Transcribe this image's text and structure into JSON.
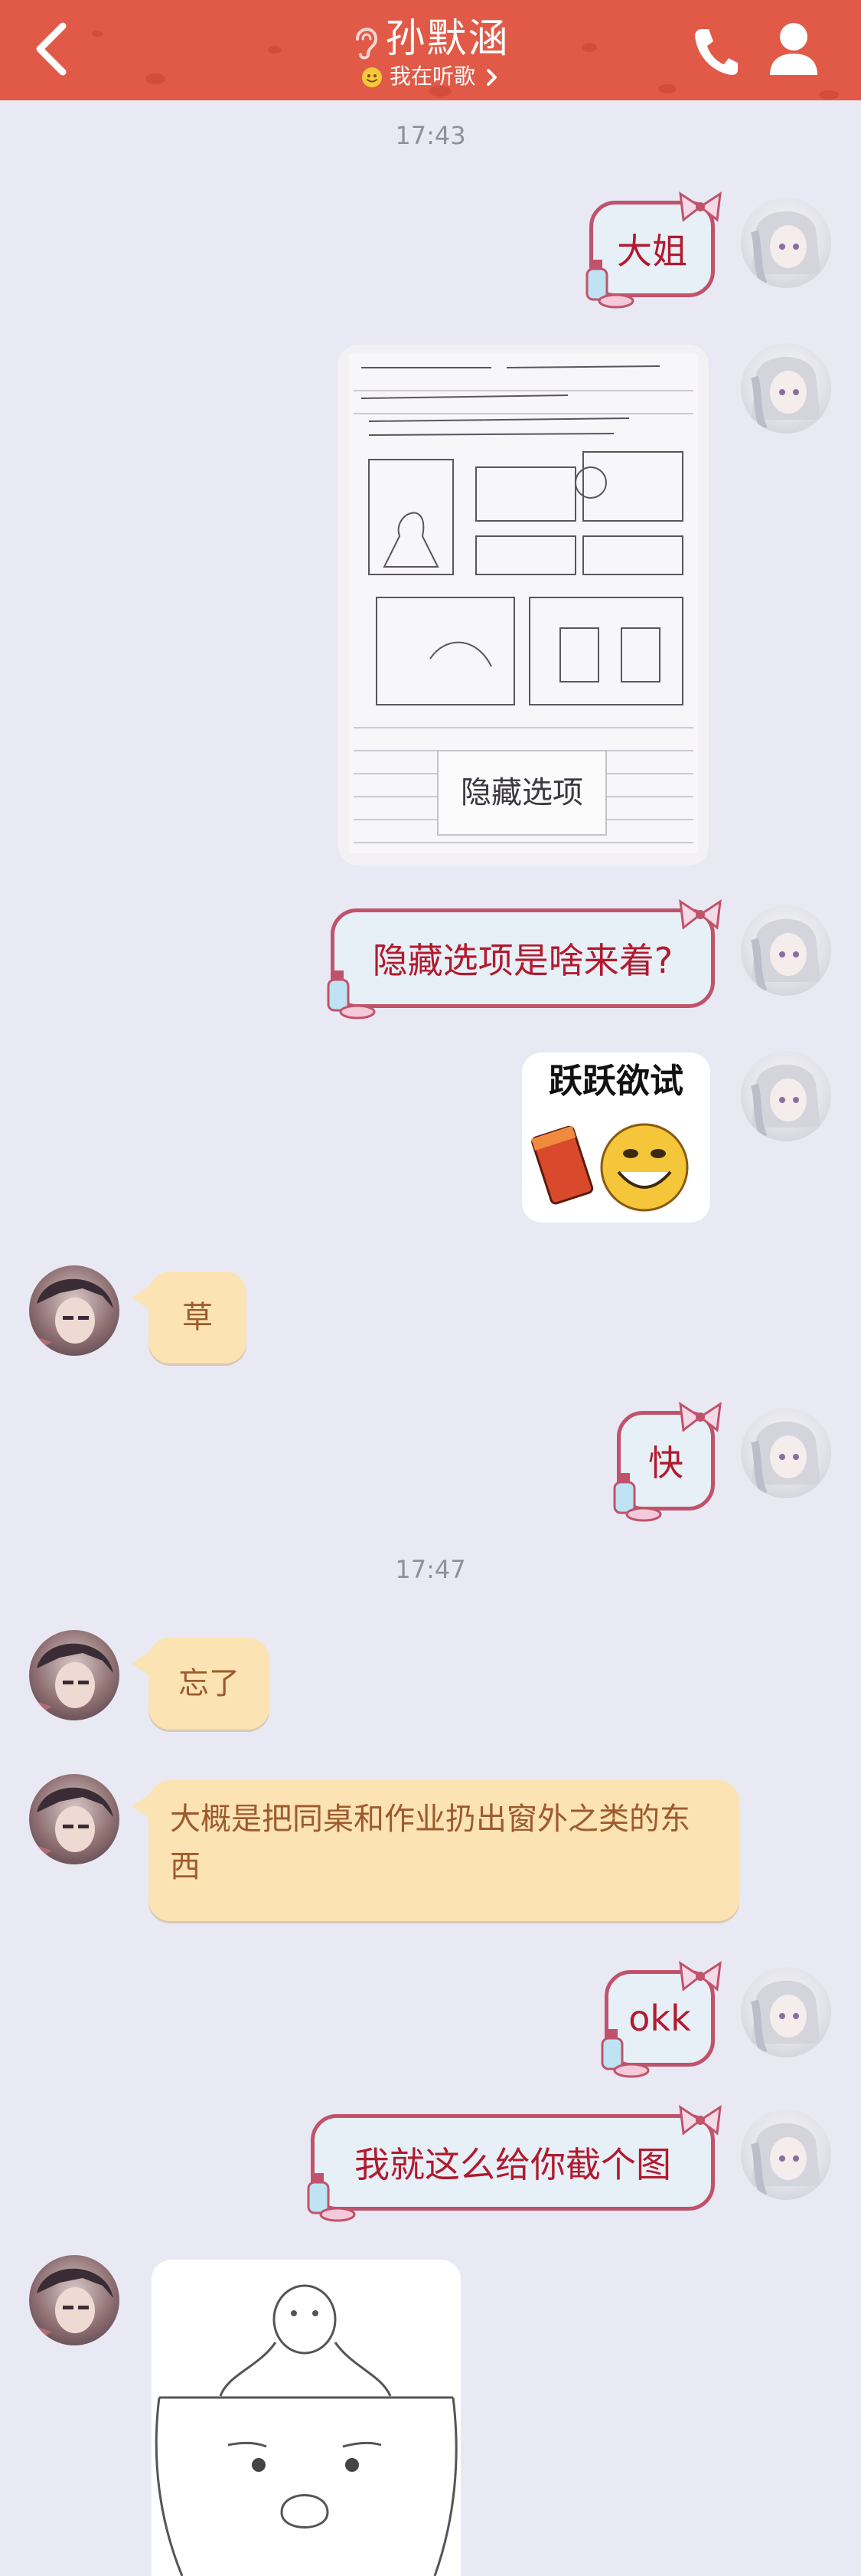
{
  "header": {
    "title": "孙默涵",
    "status": "我在听歌",
    "colors": {
      "bar": "#e05a47"
    }
  },
  "messages": {
    "ts1": "17:43",
    "m1": "大姐",
    "m2_image_text": "隐藏选项",
    "m3": "隐藏选项是啥来着?",
    "m4_sticker_text": "跃跃欲试",
    "m5": "草",
    "m6": "快",
    "ts2": "17:47",
    "m7": "忘了",
    "m8": "大概是把同桌和作业扔出窗外之类的东西",
    "m9": "okk",
    "m10": "我就这么给你截个图"
  },
  "icons": [
    "back-arrow-icon",
    "ear-icon",
    "smiley-icon",
    "chevron-right-icon",
    "phone-icon",
    "profile-icon"
  ],
  "colors": {
    "background": "#e9e9f4",
    "my_bubble_border": "#c0536b",
    "my_bubble_text": "#b21a2e",
    "other_bubble_bg": "#fbe3b3",
    "other_bubble_text": "#9d5a2e"
  }
}
